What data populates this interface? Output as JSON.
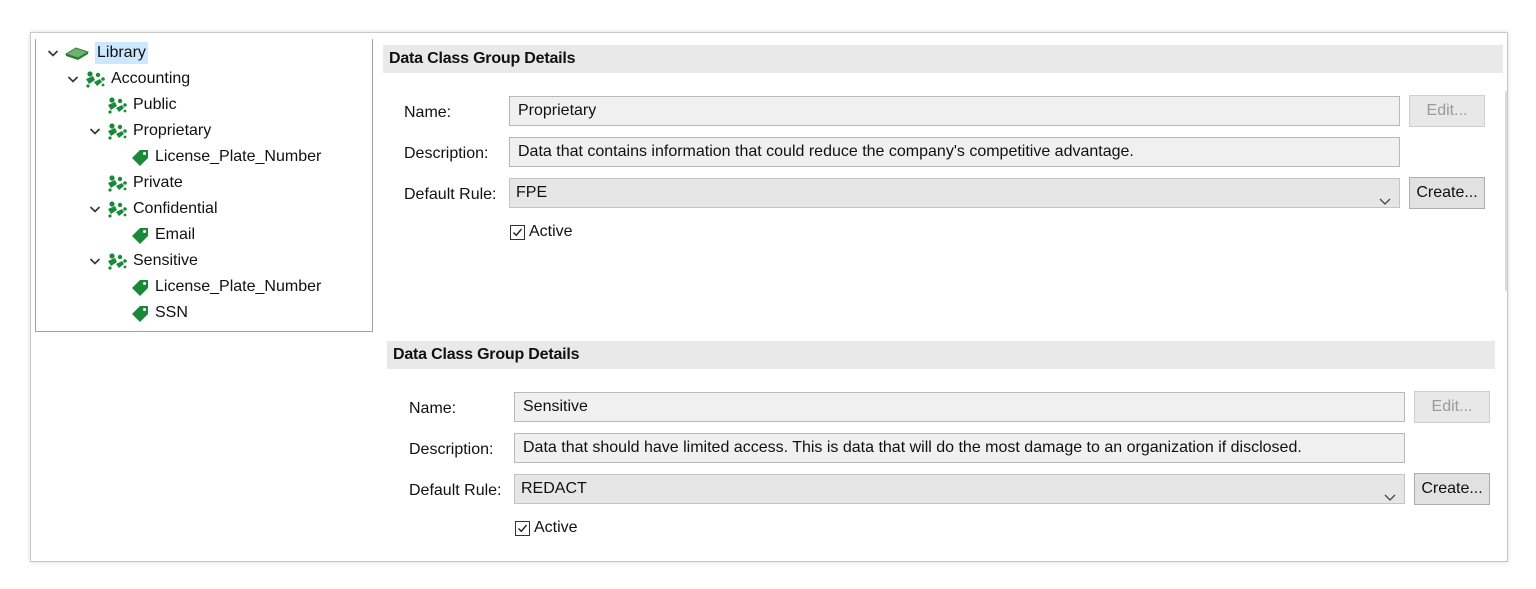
{
  "tree": {
    "items": [
      {
        "label": "Library",
        "level": 0,
        "expanded": true,
        "icon": "library-icon",
        "selected": true
      },
      {
        "label": "Accounting",
        "level": 1,
        "expanded": true,
        "icon": "group-icon"
      },
      {
        "label": "Public",
        "level": 2,
        "expanded": null,
        "icon": "group-icon"
      },
      {
        "label": "Proprietary",
        "level": 2,
        "expanded": true,
        "icon": "group-icon"
      },
      {
        "label": "License_Plate_Number",
        "level": 3,
        "expanded": null,
        "icon": "tag-icon"
      },
      {
        "label": "Private",
        "level": 2,
        "expanded": null,
        "icon": "group-icon"
      },
      {
        "label": "Confidential",
        "level": 2,
        "expanded": true,
        "icon": "group-icon"
      },
      {
        "label": "Email",
        "level": 3,
        "expanded": null,
        "icon": "tag-icon"
      },
      {
        "label": "Sensitive",
        "level": 2,
        "expanded": true,
        "icon": "group-icon"
      },
      {
        "label": "License_Plate_Number",
        "level": 3,
        "expanded": null,
        "icon": "tag-icon"
      },
      {
        "label": "SSN",
        "level": 3,
        "expanded": null,
        "icon": "tag-icon"
      }
    ]
  },
  "panels": [
    {
      "header": "Data Class Group Details",
      "name_label": "Name:",
      "name_value": "Proprietary",
      "description_label": "Description:",
      "description_value": "Data that contains information that could reduce the company's competitive advantage.",
      "rule_label": "Default Rule:",
      "rule_value": "FPE",
      "edit_label": "Edit...",
      "create_label": "Create...",
      "active_label": "Active",
      "active_checked": true
    },
    {
      "header": "Data Class Group Details",
      "name_label": "Name:",
      "name_value": "Sensitive",
      "description_label": "Description:",
      "description_value": "Data that should have limited access. This is data that will do the most damage to an organization if disclosed.",
      "rule_label": "Default Rule:",
      "rule_value": "REDACT",
      "edit_label": "Edit...",
      "create_label": "Create...",
      "active_label": "Active",
      "active_checked": true
    }
  ],
  "colors": {
    "icon_green": "#1a8a3a",
    "selection": "#cce8ff",
    "header_bg": "#e9e9e9"
  }
}
